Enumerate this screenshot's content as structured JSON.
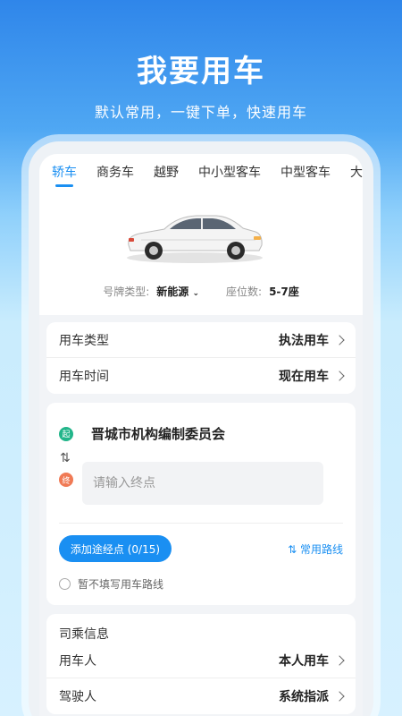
{
  "hero": {
    "title": "我要用车",
    "subtitle": "默认常用，一键下单，快速用车"
  },
  "tabs": [
    {
      "label": "轿车",
      "active": true
    },
    {
      "label": "商务车",
      "active": false
    },
    {
      "label": "越野",
      "active": false
    },
    {
      "label": "中小型客车",
      "active": false
    },
    {
      "label": "中型客车",
      "active": false
    },
    {
      "label": "大",
      "active": false
    }
  ],
  "specs": {
    "plate_label": "号牌类型:",
    "plate_value": "新能源",
    "seat_label": "座位数:",
    "seat_value": "5-7座"
  },
  "order": {
    "type_label": "用车类型",
    "type_value": "执法用车",
    "time_label": "用车时间",
    "time_value": "现在用车"
  },
  "route": {
    "start_badge": "起",
    "start_text": "晋城市机构编制委员会",
    "end_badge": "终",
    "end_placeholder": "请输入终点",
    "swap_icon": "⇅",
    "add_waypoint": "添加途经点 (0/15)",
    "common_route": "常用路线",
    "no_route": "暂不填写用车路线"
  },
  "passenger": {
    "section_title": "司乘信息",
    "user_label": "用车人",
    "user_value": "本人用车",
    "driver_label": "驾驶人",
    "driver_value": "系统指派"
  },
  "colors": {
    "accent": "#1a8ff2",
    "start": "#22b58a",
    "end": "#f07a55"
  }
}
